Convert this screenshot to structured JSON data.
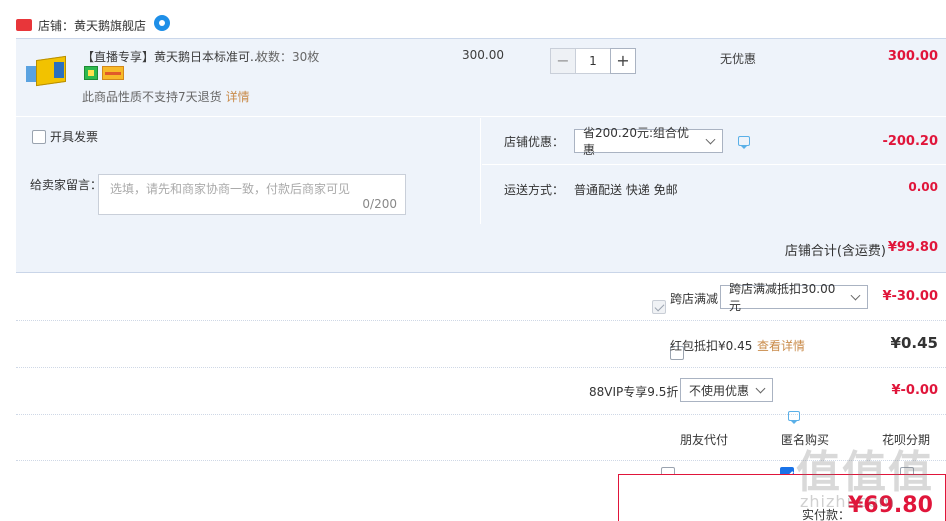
{
  "shop": {
    "label": "店铺：黄天鹅旗舰店"
  },
  "item": {
    "title": "【直播专享】黄天鹅日本标准可...",
    "sku": "枚数：30枚",
    "return_note": "此商品性质不支持7天退货",
    "return_link": "详情",
    "unit_price": "300.00",
    "quantity": "1",
    "qty_minus": "−",
    "qty_plus": "+",
    "discount_status": "无优惠",
    "total": "300.00"
  },
  "invoice": {
    "label": "开具发票",
    "checked": false
  },
  "message": {
    "label": "给卖家留言：",
    "placeholder": "选填，请先和商家协商一致，付款后商家可见",
    "count": "0/200"
  },
  "store_discount": {
    "label": "店铺优惠：",
    "selected": "省200.20元:组合优惠",
    "amount": "-200.20"
  },
  "shipping": {
    "label": "运送方式：",
    "value": "普通配送 快递 免邮",
    "amount": "0.00"
  },
  "subtotal": {
    "label": "店铺合计(含运费)",
    "amount": "¥99.80"
  },
  "cross_store": {
    "label": "跨店满减",
    "selected": "跨店满减抵扣30.00元",
    "amount": "¥-30.00",
    "checked": true
  },
  "red_packet": {
    "label": "红包抵扣¥0.45",
    "link": "查看详情",
    "amount": "¥0.45",
    "checked": false
  },
  "vip": {
    "label": "88VIP专享9.5折",
    "selected": "不使用优惠",
    "amount": "¥-0.00"
  },
  "options": {
    "friend_pay": "朋友代付",
    "anonymous": "匿名购买",
    "huabei": "花呗分期"
  },
  "payment": {
    "label": "实付款：",
    "amount": "¥69.80"
  },
  "watermark": {
    "main": "值值值",
    "sub": "zhizhi.com"
  }
}
